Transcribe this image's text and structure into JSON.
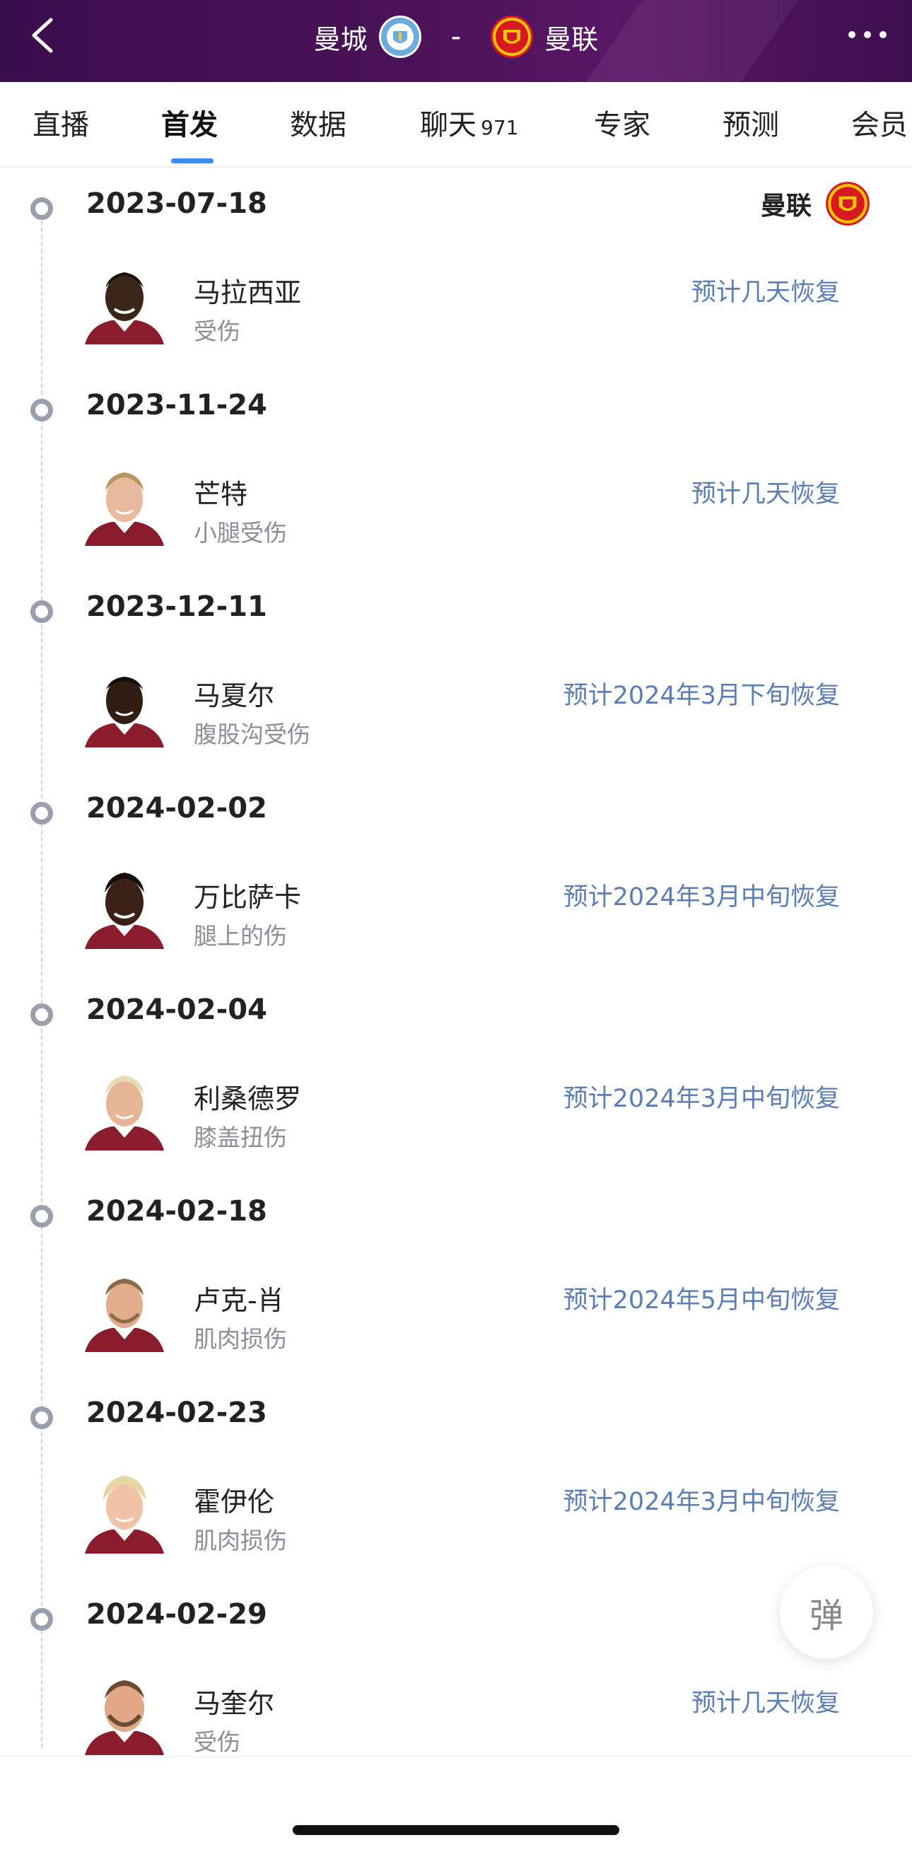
{
  "header": {
    "home_team": "曼城",
    "separator": "-",
    "away_team": "曼联",
    "back_icon": "chevron-left-icon",
    "more_icon": "more-horizontal-icon"
  },
  "tabs": [
    {
      "label": "直播",
      "active": false
    },
    {
      "label": "首发",
      "active": true
    },
    {
      "label": "数据",
      "active": false
    },
    {
      "label": "聊天",
      "count": "971",
      "active": false
    },
    {
      "label": "专家",
      "active": false
    },
    {
      "label": "预测",
      "active": false
    },
    {
      "label": "会员",
      "active": false
    }
  ],
  "team_tag": {
    "name": "曼联"
  },
  "injuries": [
    {
      "date": "2023-07-18",
      "name": "马拉西亚",
      "injury": "受伤",
      "recovery": "预计几天恢复"
    },
    {
      "date": "2023-11-24",
      "name": "芒特",
      "injury": "小腿受伤",
      "recovery": "预计几天恢复"
    },
    {
      "date": "2023-12-11",
      "name": "马夏尔",
      "injury": "腹股沟受伤",
      "recovery": "预计2024年3月下旬恢复"
    },
    {
      "date": "2024-02-02",
      "name": "万比萨卡",
      "injury": "腿上的伤",
      "recovery": "预计2024年3月中旬恢复"
    },
    {
      "date": "2024-02-04",
      "name": "利桑德罗",
      "injury": "膝盖扭伤",
      "recovery": "预计2024年3月中旬恢复"
    },
    {
      "date": "2024-02-18",
      "name": "卢克-肖",
      "injury": "肌肉损伤",
      "recovery": "预计2024年5月中旬恢复"
    },
    {
      "date": "2024-02-23",
      "name": "霍伊伦",
      "injury": "肌肉损伤",
      "recovery": "预计2024年3月中旬恢复"
    },
    {
      "date": "2024-02-29",
      "name": "马奎尔",
      "injury": "受伤",
      "recovery": "预计几天恢复"
    }
  ],
  "float_button": {
    "label": "弹"
  },
  "colors": {
    "header_bg": "#4a1258",
    "tab_indicator": "#3b8cf0",
    "recovery_text": "#5b7fb5",
    "timeline_dot": "#9a9fad"
  }
}
